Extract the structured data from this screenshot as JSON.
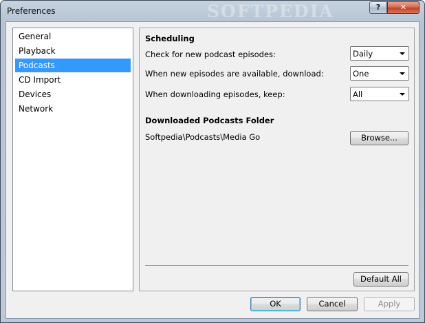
{
  "window": {
    "title": "Preferences",
    "watermark": "SOFTPEDIA",
    "help_glyph": "?",
    "close_glyph": "✕"
  },
  "nav": {
    "items": [
      {
        "label": "General"
      },
      {
        "label": "Playback"
      },
      {
        "label": "Podcasts",
        "selected": true
      },
      {
        "label": "CD Import"
      },
      {
        "label": "Devices"
      },
      {
        "label": "Network"
      }
    ]
  },
  "scheduling": {
    "title": "Scheduling",
    "check_label": "Check for new podcast episodes:",
    "check_value": "Daily",
    "download_label": "When new episodes are available, download:",
    "download_value": "One",
    "keep_label": "When downloading episodes, keep:",
    "keep_value": "All"
  },
  "folder": {
    "title": "Downloaded Podcasts Folder",
    "path": "Softpedia\\Podcasts\\Media Go",
    "browse_label": "Browse..."
  },
  "buttons": {
    "default_all": "Default All",
    "ok": "OK",
    "cancel": "Cancel",
    "apply": "Apply"
  },
  "colors": {
    "selection": "#3399ff",
    "close_button": "#c0432a"
  }
}
